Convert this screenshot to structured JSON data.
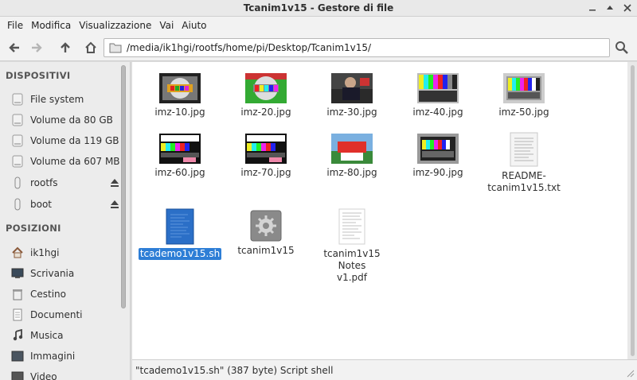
{
  "window": {
    "title": "Tcanim1v15 - Gestore di file"
  },
  "menu": [
    "File",
    "Modifica",
    "Visualizzazione",
    "Vai",
    "Aiuto"
  ],
  "toolbar": {
    "path": "/media/ik1hgi/rootfs/home/pi/Desktop/Tcanim1v15/"
  },
  "sidebar": {
    "devices_header": "DISPOSITIVI",
    "devices": [
      {
        "label": "File system",
        "icon": "drive-icon"
      },
      {
        "label": "Volume da 80 GB",
        "icon": "drive-icon"
      },
      {
        "label": "Volume da 119 GB",
        "icon": "drive-icon"
      },
      {
        "label": "Volume da 607 MB",
        "icon": "drive-icon"
      },
      {
        "label": "rootfs",
        "icon": "usb-drive-icon",
        "eject": true
      },
      {
        "label": "boot",
        "icon": "usb-drive-icon",
        "eject": true
      }
    ],
    "places_header": "POSIZIONI",
    "places": [
      {
        "label": "ik1hgi",
        "icon": "home-icon"
      },
      {
        "label": "Scrivania",
        "icon": "desktop-icon"
      },
      {
        "label": "Cestino",
        "icon": "trash-icon"
      },
      {
        "label": "Documenti",
        "icon": "documents-icon"
      },
      {
        "label": "Musica",
        "icon": "music-icon"
      },
      {
        "label": "Immagini",
        "icon": "pictures-icon"
      },
      {
        "label": "Video",
        "icon": "video-icon"
      }
    ]
  },
  "files": [
    {
      "name": "imz-10.jpg",
      "type": "image"
    },
    {
      "name": "imz-20.jpg",
      "type": "image"
    },
    {
      "name": "imz-30.jpg",
      "type": "image"
    },
    {
      "name": "imz-40.jpg",
      "type": "image"
    },
    {
      "name": "imz-50.jpg",
      "type": "image"
    },
    {
      "name": "imz-60.jpg",
      "type": "image"
    },
    {
      "name": "imz-70.jpg",
      "type": "image"
    },
    {
      "name": "imz-80.jpg",
      "type": "image"
    },
    {
      "name": "imz-90.jpg",
      "type": "image"
    },
    {
      "name_line1": "README-",
      "name_line2": "tcanim1v15.txt",
      "type": "text"
    },
    {
      "name": "tcademo1v15.sh",
      "type": "script",
      "selected": true
    },
    {
      "name": "tcanim1v15",
      "type": "executable"
    },
    {
      "name_line1": "tcanim1v15 Notes",
      "name_line2": "v1.pdf",
      "type": "pdf"
    }
  ],
  "status": {
    "text": "\"tcademo1v15.sh\" (387 byte) Script shell"
  },
  "colors": {
    "selection": "#2d7ed6",
    "script_icon": "#2b6fc7"
  }
}
